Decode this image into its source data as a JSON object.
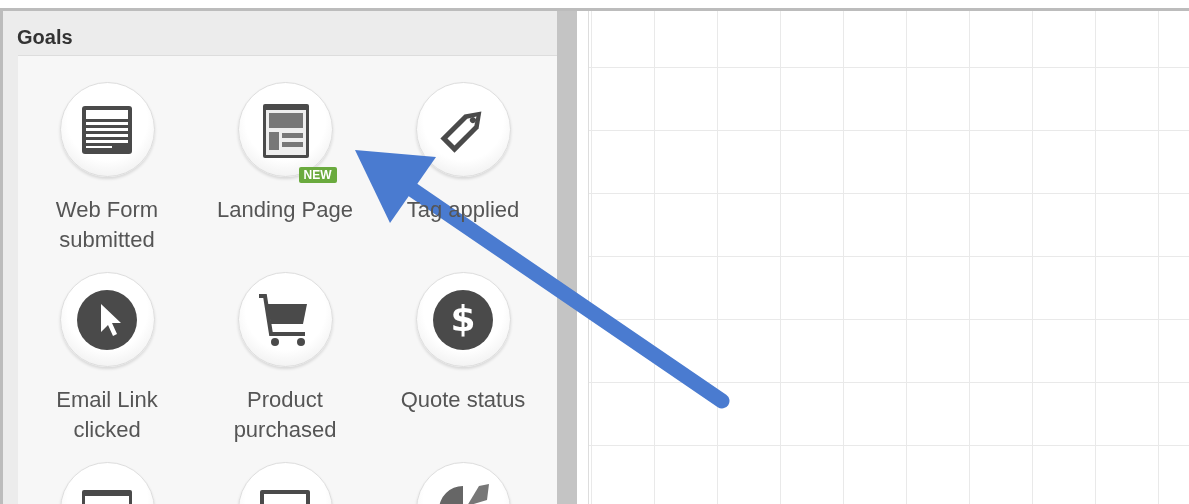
{
  "panel": {
    "title": "Goals",
    "items": [
      {
        "kind": "form",
        "label": "Web Form submitted"
      },
      {
        "kind": "page",
        "label": "Landing Page",
        "badge": "NEW"
      },
      {
        "kind": "tag",
        "label": "Tag applied"
      },
      {
        "kind": "pointer",
        "label": "Email Link clicked"
      },
      {
        "kind": "cart",
        "label": "Product purchased"
      },
      {
        "kind": "dollar",
        "glyph": "$",
        "label": "Quote status"
      },
      {
        "kind": "window"
      },
      {
        "kind": "card"
      },
      {
        "kind": "gauge"
      }
    ]
  }
}
